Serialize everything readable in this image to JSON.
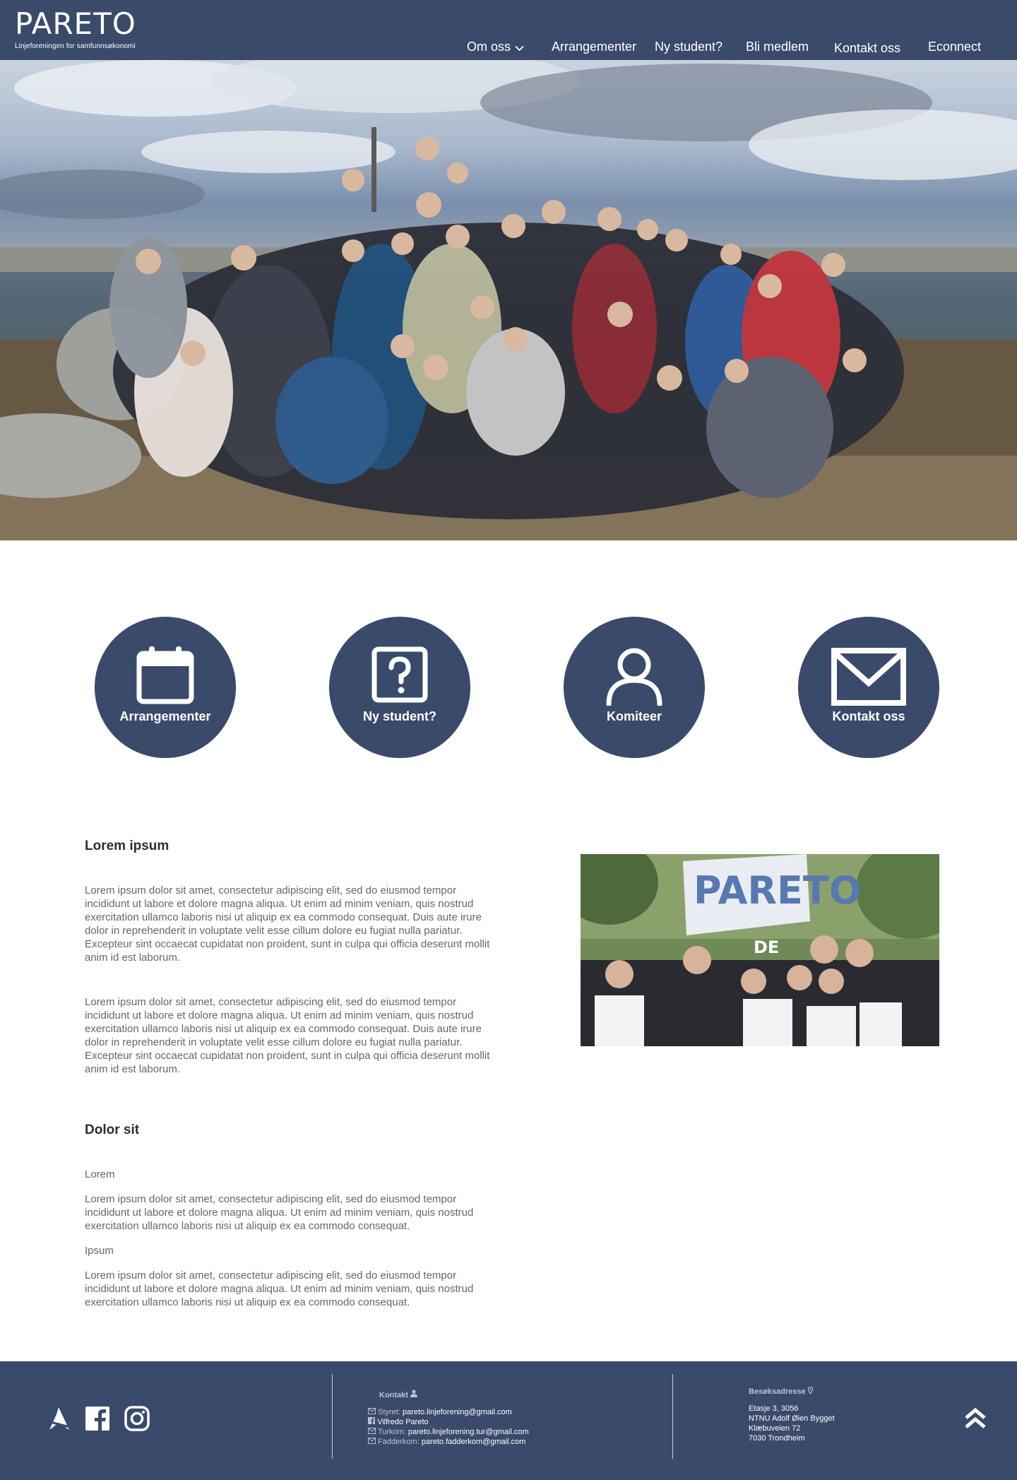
{
  "header": {
    "logo_text": "PARETO",
    "logo_tagline": "Linjeforeningen for samfunnsøkonomi",
    "nav": [
      {
        "label": "Om oss",
        "has_dropdown": true
      },
      {
        "label": "Arrangementer"
      },
      {
        "label": "Ny student?"
      },
      {
        "label": "Bli medlem"
      },
      {
        "label": "Kontakt oss"
      },
      {
        "label": "Econnect"
      }
    ]
  },
  "hero": {
    "image": "group-photo-mountain"
  },
  "quick_links": [
    {
      "label": "Arrangementer",
      "icon": "calendar-icon"
    },
    {
      "label": "Ny student?",
      "icon": "question-icon"
    },
    {
      "label": "Komiteer",
      "icon": "user-icon"
    },
    {
      "label": "Kontakt oss",
      "icon": "envelope-icon"
    }
  ],
  "section1": {
    "title": "Lorem ipsum",
    "paragraphs": [
      "Lorem ipsum dolor sit amet, consectetur adipiscing elit, sed do eiusmod tempor incididunt ut labore et dolore magna aliqua. Ut enim ad minim veniam, quis nostrud exercitation ullamco laboris nisi ut aliquip ex ea commodo consequat. Duis aute irure dolor in reprehenderit in voluptate velit esse cillum dolore eu fugiat nulla pariatur. Excepteur sint occaecat cupidatat non proident, sunt in culpa qui officia deserunt mollit anim id est laborum.",
      "Lorem ipsum dolor sit amet, consectetur adipiscing elit, sed do eiusmod tempor incididunt ut labore et dolore magna aliqua. Ut enim ad minim veniam, quis nostrud exercitation ullamco laboris nisi ut aliquip ex ea commodo consequat. Duis aute irure dolor in reprehenderit in voluptate velit esse cillum dolore eu fugiat nulla pariatur. Excepteur sint occaecat cupidatat non proident, sunt in culpa qui officia deserunt mollit anim id est laborum."
    ]
  },
  "section2": {
    "title": "Dolor sit",
    "items": [
      {
        "subtitle": "Lorem",
        "text": "Lorem ipsum dolor sit amet, consectetur adipiscing elit, sed do eiusmod tempor incididunt ut labore et dolore magna aliqua. Ut enim ad minim veniam, quis nostrud exercitation ullamco laboris nisi ut aliquip ex ea commodo consequat."
      },
      {
        "subtitle": "Ipsum",
        "text": "Lorem ipsum dolor sit amet, consectetur adipiscing elit, sed do eiusmod tempor incididunt ut labore et dolore magna aliqua. Ut enim ad minim veniam, quis nostrud exercitation ullamco laboris nisi ut aliquip ex ea commodo consequat."
      }
    ]
  },
  "side_photo": {
    "banner_text": "PARETO",
    "banner_sub": "DE"
  },
  "footer": {
    "social": [
      "pareto-logo-icon",
      "facebook-icon",
      "instagram-icon"
    ],
    "kontakt_title": "Kontakt",
    "contacts": [
      {
        "label": "Styret:",
        "value": "pareto.linjeforening@gmail.com",
        "icon": "mail-icon"
      },
      {
        "label": "",
        "value": "Vilfredo Pareto",
        "icon": "facebook-small-icon"
      },
      {
        "label": "Turkom:",
        "value": "pareto.linjeforening.tur@gmail.com",
        "icon": "mail-icon"
      },
      {
        "label": "Fadderkom:",
        "value": "pareto.fadderkom@gmail.com",
        "icon": "mail-icon"
      }
    ],
    "address_title": "Besøksadresse",
    "address": [
      "Etasje 3, 3056",
      "NTNU Adolf Øien Bygget",
      "Klæbuveien 72",
      "7030 Trondheim"
    ]
  },
  "colors": {
    "primary": "#3a4a6b",
    "text": "#666666",
    "heading": "#2d2d2d"
  }
}
